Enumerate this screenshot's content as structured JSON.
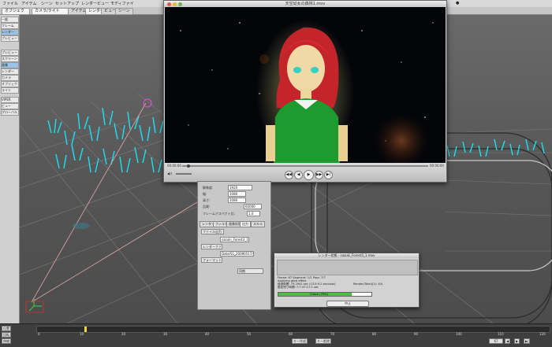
{
  "menubar": {
    "items": [
      "ファイル",
      "アイテム",
      "シーン",
      "セットアップ",
      "レンダー",
      "ビュー",
      "モディファイ"
    ]
  },
  "toolbar": {
    "tabs": [
      "アイテム",
      "シーン",
      "レンダー",
      "ビュー"
    ],
    "active": "レンダー",
    "mode_value": "オブジェクト",
    "mode_menu": "カメラ/ライト"
  },
  "left_tools": [
    "一般",
    "フレーム",
    "レンダー",
    "プレビュー",
    "プレビュー",
    "スクリーン",
    "画像",
    "レンダー",
    "カメラ",
    "オブジェクト",
    "ライト",
    "VIPER",
    "ビュー",
    "グローバル"
  ],
  "video_window": {
    "title": "天空幼女の森林1.mov",
    "time_value": "00:00:00",
    "time_end": "00:00:00",
    "volume_value": "40",
    "transport": [
      "◀◀",
      "◀",
      "▶",
      "▶▶",
      "▶|"
    ]
  },
  "render_panel": {
    "fields": [
      {
        "label": "解像度:",
        "value": "1920"
      },
      {
        "label": "幅:",
        "value": "1080"
      },
      {
        "label": "高さ:",
        "value": "1080"
      },
      {
        "label": "品質:",
        "value": "60000"
      },
      {
        "label": "フレームアスペクト比:",
        "value": "1.0"
      }
    ],
    "tabs": [
      "レンダー",
      "フィルタ",
      "画像処理",
      "出力",
      "スキル"
    ],
    "output_buttons": [
      "ファイル出力",
      "レンダーファイル",
      "フォーマット"
    ],
    "filename": "sazuki_Forest3_1.mov",
    "path": "Data/S1_20090517/...",
    "dropdown": "同期"
  },
  "status_dialog": {
    "title": "レンダー状態 - sazuki_Forest3_1.mov",
    "rows": [
      "Frame: 67   Segment: 1/1   Pass: 7/7",
      "Applying glow effect",
      "経過時間: 79.2941 sec (13:3:9.2 seconds)",
      "推定残り時間: 7:7:37:17.1 sec",
      "Render(Total)(1): 4/4"
    ],
    "progress_label": "Check (79%)",
    "progress": 0.79,
    "abort_label": "中止"
  },
  "timeline": {
    "ticks": [
      "0",
      "10",
      "20",
      "30",
      "40",
      "50",
      "60",
      "70",
      "80",
      "90",
      "100",
      "110",
      "120"
    ],
    "buttons": [
      "位置",
      "回転",
      "伸縮",
      "キー作成",
      "キー削除"
    ],
    "current_frame": "67"
  }
}
